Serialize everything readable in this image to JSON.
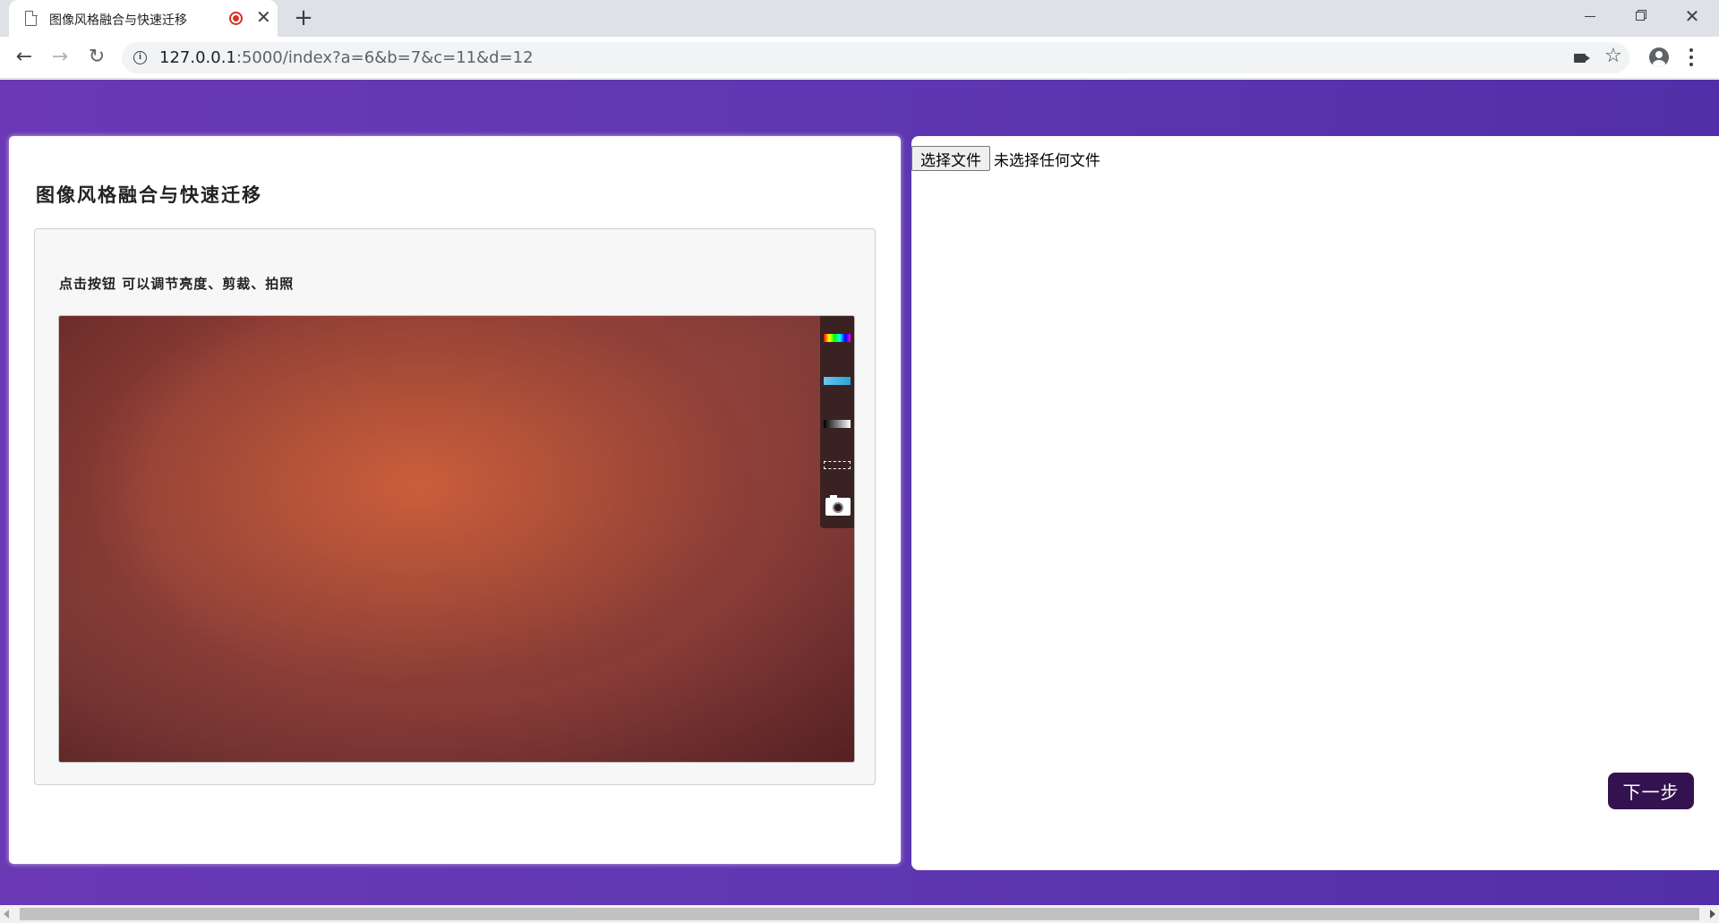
{
  "browser": {
    "tab_title": "图像风格融合与快速迁移",
    "tab_close_glyph": "✕",
    "newtab_glyph": "+",
    "close_glyph": "✕",
    "url_host": "127.0.0.1",
    "url_rest": ":5000/index?a=6&b=7&c=11&d=12",
    "back_glyph": "←",
    "forward_glyph": "→",
    "reload_glyph": "↻",
    "star_glyph": "☆",
    "info_glyph": "i"
  },
  "page": {
    "heading": "图像风格融合与快速迁移",
    "webcam_hint": "点击按钮 可以调节亮度、剪裁、拍照",
    "choose_file_label": "选择文件",
    "file_status": "未选择任何文件",
    "next_label": "下一步"
  },
  "colors": {
    "background_gradient": [
      "#6a38b4",
      "#512fa8"
    ],
    "next_button": "#34124f",
    "record_indicator": "#d93025"
  },
  "icons": [
    "file-icon",
    "recording-icon",
    "close-icon",
    "plus-icon",
    "back-icon",
    "forward-icon",
    "reload-icon",
    "info-icon",
    "camera-icon",
    "star-icon",
    "profile-icon",
    "menu-icon",
    "color-filter-icon",
    "blue-filter-icon",
    "grayscale-filter-icon",
    "crop-icon",
    "snapshot-camera-icon"
  ]
}
